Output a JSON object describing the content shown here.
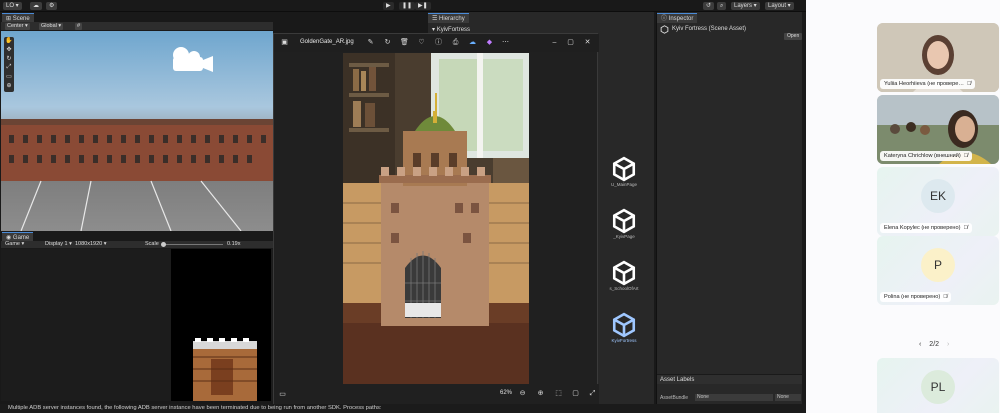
{
  "unity": {
    "toolbar": {
      "account": "LO",
      "layers": "Layers",
      "layout": "Layout"
    },
    "scene": {
      "tab": "Scene",
      "pivot": "Center",
      "space": "Global"
    },
    "game": {
      "tab": "Game",
      "mode": "Game",
      "display": "Display 1",
      "resolution": "1080x1920",
      "scale_label": "Scale",
      "scale_value": "0.19x"
    },
    "hierarchy": {
      "tab": "Hierarchy",
      "root": "KyivFortress"
    },
    "project": {
      "assets": [
        "U_MainPage",
        "_KyivPage",
        "s_SchoolOfArt",
        "KyivFortress"
      ]
    },
    "inspector": {
      "tab": "Inspector",
      "title": "Kyiv Fortress (Scene Asset)",
      "open_button": "Open",
      "asset_labels": "Asset Labels",
      "asset_bundle_label": "AssetBundle",
      "asset_bundle_value": "None",
      "variant_value": "None"
    },
    "status_message": "Multiple ADB server instances found, the following ADB server instance have been terminated due to being run from another SDK. Process paths:"
  },
  "viewer": {
    "filename": "GoldenGate_AR.jpg",
    "zoom": "62%"
  },
  "meeting": {
    "participants": [
      {
        "name": "Yuliia Heorhiieva (не провере…",
        "type": "video",
        "muted": true
      },
      {
        "name": "Kateryna Chrichlow (внешний)",
        "type": "video",
        "muted": true
      },
      {
        "name": "Elena Kopylec (не проверено)",
        "type": "avatar",
        "initials": "EK",
        "avatar_color": "#dde9ef",
        "muted": true
      },
      {
        "name": "Polina (не проверено)",
        "type": "avatar",
        "initials": "P",
        "avatar_color": "#fbf1c9",
        "muted": true
      },
      {
        "initials": "PL",
        "type": "avatar",
        "avatar_color": "#dcebdc"
      }
    ],
    "pager": "2/2"
  }
}
